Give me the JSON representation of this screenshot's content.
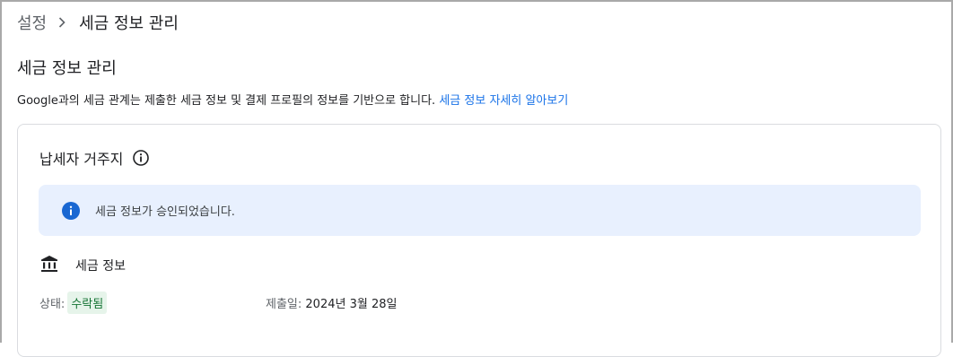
{
  "breadcrumb": {
    "parent": "설정",
    "current": "세금 정보 관리"
  },
  "page": {
    "title": "세금 정보 관리",
    "description": "Google과의 세금 관계는 제출한 세금 정보 및 결제 프로필의 정보를 기반으로 합니다.",
    "learn_more": "세금 정보 자세히 알아보기"
  },
  "card": {
    "title": "납세자 거주지",
    "banner_text": "세금 정보가 승인되었습니다.",
    "section_label": "세금 정보",
    "status_label": "상태:",
    "status_value": "수락됨",
    "submitted_label": "제출일:",
    "submitted_value": "2024년 3월 28일"
  },
  "icons": {
    "breadcrumb_separator": "chevron-right-icon",
    "header_info": "info-outline-icon",
    "banner": "info-filled-icon",
    "section": "bank-icon"
  },
  "colors": {
    "link": "#1a73e8",
    "banner_bg": "#e8f0fe",
    "banner_icon": "#1967d2",
    "status_bg": "#e6f4ea",
    "status_text": "#137333"
  }
}
